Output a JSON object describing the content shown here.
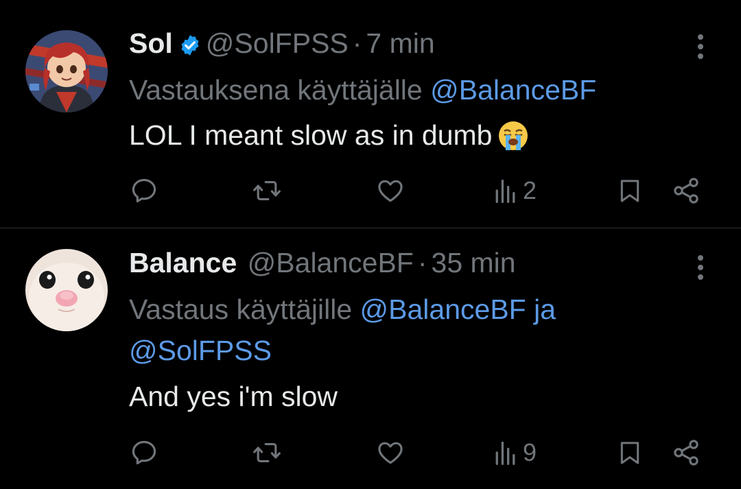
{
  "colors": {
    "background": "#000000",
    "text": "#e7e9ea",
    "muted": "#71767b",
    "link": "#5c9ae6",
    "verified": "#1d9bf0",
    "divider": "#2f3336"
  },
  "tweets": [
    {
      "name": "Sol",
      "verified": true,
      "handle": "@SolFPSS",
      "separator": "·",
      "time": "7 min",
      "reply_prefix": "Vastauksena käyttäjälle",
      "reply_to": "@BalanceBF",
      "text": "LOL I meant slow as in dumb",
      "emoji": "loudly-crying-face",
      "views": "2",
      "avatar": "anime-character-avatar"
    },
    {
      "name": "Balance",
      "verified": false,
      "handle": "@BalanceBF",
      "separator": "·",
      "time": "35 min",
      "reply_prefix": "Vastaus käyttäjille",
      "reply_to": "@BalanceBF ja",
      "reply_to_2": "@SolFPSS",
      "text": "And yes i'm slow",
      "views": "9",
      "avatar": "cat-face-avatar"
    }
  ]
}
